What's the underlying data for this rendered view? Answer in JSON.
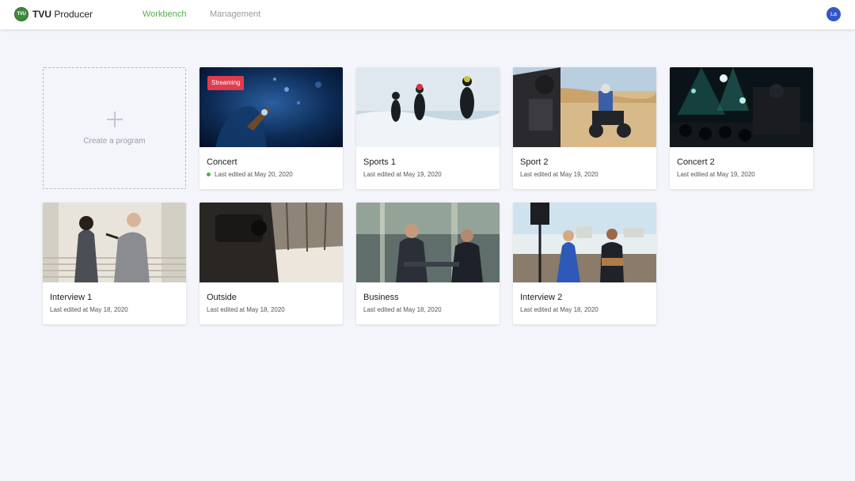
{
  "app": {
    "brand_bold": "TVU",
    "brand_rest": " Producer",
    "logo_mark": "TVU"
  },
  "nav": [
    {
      "label": "Workbench",
      "active": true
    },
    {
      "label": "Management",
      "active": false
    }
  ],
  "colors": {
    "nav_active": "#52b046",
    "streaming_badge": "#e33b4e",
    "live_dot": "#4caf50",
    "avatar": "#3456c8"
  },
  "user": {
    "initials": "La"
  },
  "create_card": {
    "label": "Create a program",
    "icon": "plus-icon"
  },
  "programs": [
    {
      "title": "Concert",
      "meta": "Last edited at May 20, 2020",
      "badge": "Streaming",
      "live": true
    },
    {
      "title": "Sports 1",
      "meta": "Last edited at May 19, 2020"
    },
    {
      "title": "Sport 2",
      "meta": "Last edited at May 19, 2020"
    },
    {
      "title": "Concert 2",
      "meta": "Last edited at May 19, 2020"
    },
    {
      "title": "Interview 1",
      "meta": "Last edited at May 18, 2020"
    },
    {
      "title": "Outside",
      "meta": "Last edited at May 18, 2020"
    },
    {
      "title": "Business",
      "meta": "Last edited at May 18, 2020"
    },
    {
      "title": "Interview 2",
      "meta": "Last edited at May 18, 2020"
    }
  ]
}
